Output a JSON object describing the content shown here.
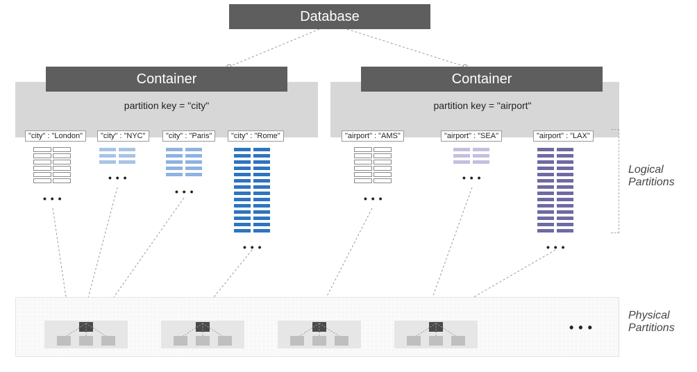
{
  "database": {
    "title": "Database"
  },
  "containers": [
    {
      "title": "Container",
      "partition_key_label": "partition key = \"city\"",
      "partitions": [
        {
          "label": "\"city\" : \"London\"",
          "color": "#ffffff",
          "rows": 6
        },
        {
          "label": "\"city\" : \"NYC\"",
          "color": "#a9c3e6",
          "rows": 3
        },
        {
          "label": "\"city\" : \"Paris\"",
          "color": "#8fb2df",
          "rows": 5
        },
        {
          "label": "\"city\" : \"Rome\"",
          "color": "#2f74c0",
          "rows": 14
        }
      ]
    },
    {
      "title": "Container",
      "partition_key_label": "partition key = \"airport\"",
      "partitions": [
        {
          "label": "\"airport\" : \"AMS\"",
          "color": "#ffffff",
          "rows": 6
        },
        {
          "label": "\"airport\" : \"SEA\"",
          "color": "#c4bfe0",
          "rows": 3
        },
        {
          "label": "\"airport\" : \"LAX\"",
          "color": "#6e6aa3",
          "rows": 14
        }
      ]
    }
  ],
  "labels": {
    "logical": "Logical\nPartitions",
    "physical": "Physical\nPartitions",
    "ellipsis": "• • •"
  }
}
